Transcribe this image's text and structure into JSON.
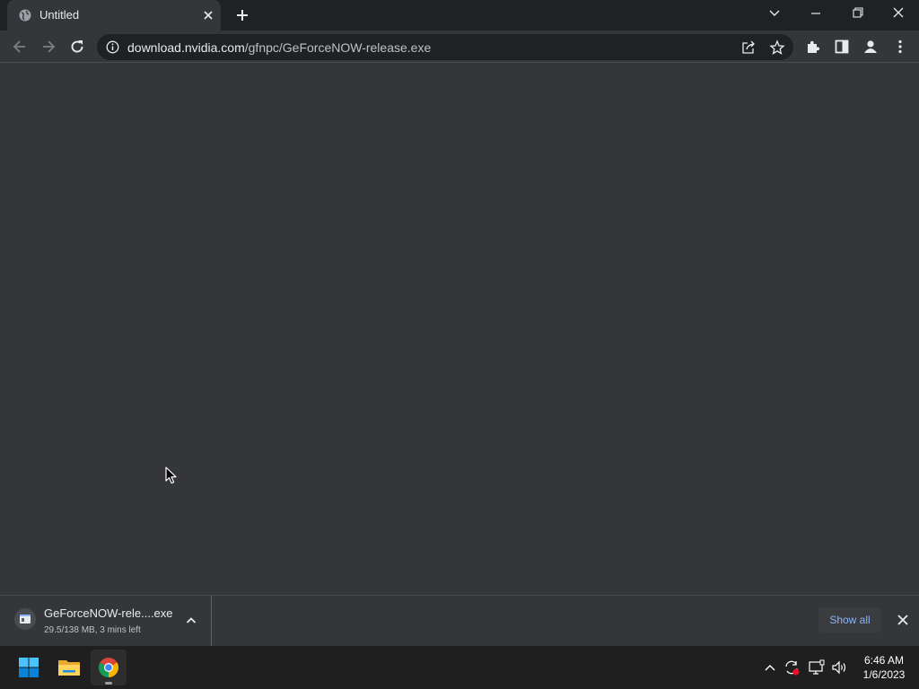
{
  "browser": {
    "tab": {
      "title": "Untitled",
      "favicon": "globe-icon"
    },
    "address": {
      "host": "download.nvidia.com",
      "path": "/gfnpc/GeForceNOW-release.exe"
    }
  },
  "download_bar": {
    "item": {
      "filename": "GeForceNOW-rele....exe",
      "status": "29.5/138 MB, 3 mins left"
    },
    "show_all_label": "Show all"
  },
  "taskbar": {
    "apps": [
      "start",
      "file-explorer",
      "chrome"
    ],
    "clock": {
      "time": "6:46 AM",
      "date": "1/6/2023"
    }
  },
  "colors": {
    "titlebar": "#202124",
    "toolbar": "#35363a",
    "accent_link": "#8ab4f8",
    "taskbar": "#1f1f1f"
  }
}
